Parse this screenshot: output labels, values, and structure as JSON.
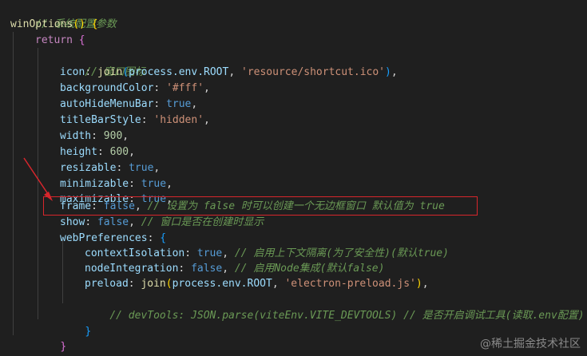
{
  "code": {
    "comment_config": "// 系统配置参数",
    "fn_name": "winOptions",
    "paren": "()",
    "brace_open": " {",
    "kw_return": "return",
    "comment_icon": "// 窗口图标",
    "icon": {
      "key": "icon",
      "fn": "join",
      "arg1": "process.env.ROOT",
      "arg2": "'resource/shortcut.ico'"
    },
    "backgroundColor": {
      "key": "backgroundColor",
      "value": "'#fff'"
    },
    "autoHideMenuBar": {
      "key": "autoHideMenuBar",
      "value": "true"
    },
    "titleBarStyle": {
      "key": "titleBarStyle",
      "value": "'hidden'"
    },
    "width": {
      "key": "width",
      "value": "900"
    },
    "height": {
      "key": "height",
      "value": "600"
    },
    "resizable": {
      "key": "resizable",
      "value": "true"
    },
    "minimizable": {
      "key": "minimizable",
      "value": "true"
    },
    "maximizable": {
      "key": "maximizable",
      "value": "true"
    },
    "frame": {
      "key": "frame",
      "value": "false",
      "comment": "// 设置为 false 时可以创建一个无边框窗口 默认值为 true"
    },
    "show": {
      "key": "show",
      "value": "false",
      "comment": "// 窗口是否在创建时显示"
    },
    "webPreferences": {
      "key": "webPreferences"
    },
    "contextIsolation": {
      "key": "contextIsolation",
      "value": "true",
      "comment": "// 启用上下文隔离(为了安全性)(默认true)"
    },
    "nodeIntegration": {
      "key": "nodeIntegration",
      "value": "false",
      "comment": "// 启用Node集成(默认false)"
    },
    "preload": {
      "key": "preload",
      "fn": "join",
      "arg1": "process.env.ROOT",
      "arg2": "'electron-preload.js'"
    },
    "devtools_comment": "// devTools: JSON.parse(viteEnv.VITE_DEVTOOLS) // 是否开启调试工具(读取.env配置)",
    "close_brace": "}",
    "close_brace_inner": "},"
  },
  "watermark": "@稀土掘金技术社区",
  "colors": {
    "background": "#1f1f1f",
    "highlight_box": "#d7262c",
    "arrow": "#d7262c"
  }
}
